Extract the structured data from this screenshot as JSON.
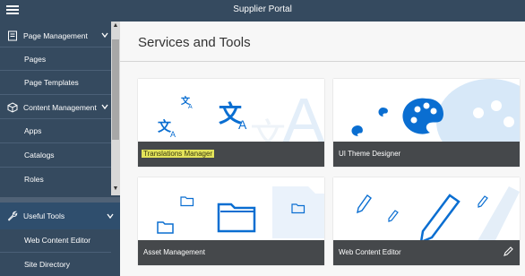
{
  "header": {
    "title": "Supplier Portal"
  },
  "sidebar": {
    "groups": [
      {
        "label": "Page Management",
        "items": [
          "Pages",
          "Page Templates"
        ]
      },
      {
        "label": "Content Management",
        "items": [
          "Apps",
          "Catalogs",
          "Roles"
        ]
      }
    ],
    "useful": {
      "label": "Useful Tools",
      "items": [
        "Web Content Editor",
        "Site Directory"
      ]
    }
  },
  "main": {
    "title": "Services and Tools",
    "tiles": [
      {
        "label": "Translations Manager",
        "highlighted": true,
        "icon": "translate-icon"
      },
      {
        "label": "UI Theme Designer",
        "icon": "palette-icon"
      },
      {
        "label": "Asset Management",
        "icon": "folder-icon"
      },
      {
        "label": "Web Content Editor",
        "icon": "pencil-icon"
      }
    ]
  },
  "colors": {
    "shell": "#354a5f",
    "tile_band": "#45484b",
    "accent": "#0a6ed1",
    "highlight": "#e3e35a"
  }
}
